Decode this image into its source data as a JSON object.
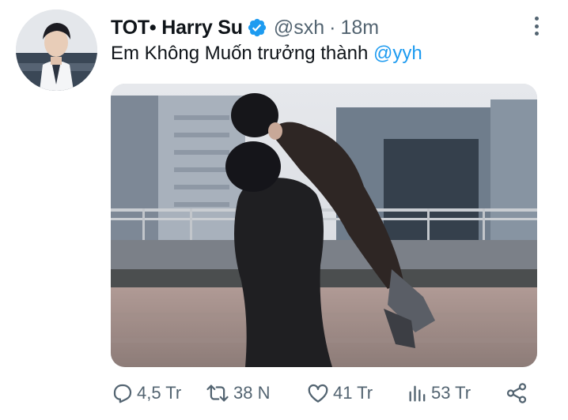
{
  "tweet": {
    "author": {
      "display_name": "TOT• Harry Su",
      "handle": "@sxh",
      "separator": "·",
      "time": "18m",
      "verified_icon": "verified-badge-icon"
    },
    "text": "Em Không Muốn trưởng thành",
    "mention": "@yyh",
    "actions": {
      "reply_count": "4,5 Tr",
      "retweet_count": "38 N",
      "like_count": "41 Tr",
      "views_count": "53 Tr"
    }
  },
  "colors": {
    "accent": "#1d9bf0",
    "text_primary": "#0f1419",
    "text_secondary": "#536471"
  },
  "icons": [
    "more-vertical-icon",
    "reply-icon",
    "retweet-icon",
    "like-icon",
    "views-icon",
    "share-icon"
  ]
}
